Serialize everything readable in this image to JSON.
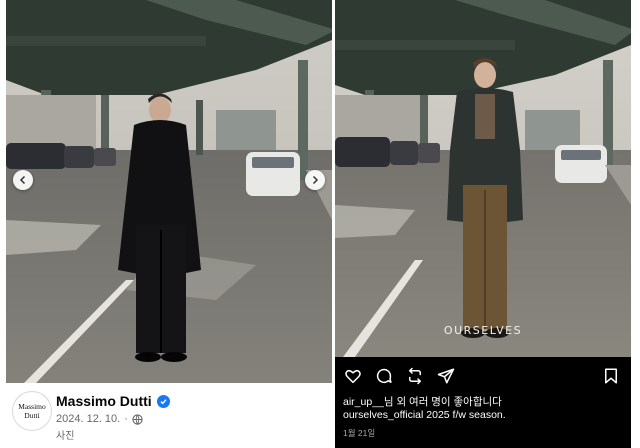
{
  "left_post": {
    "page_name": "Massimo Dutti",
    "avatar_logo_text": "Massimo Dutti",
    "date": "2024. 12. 10.",
    "separator": "·",
    "post_type": "사진",
    "brand_color": "#1877f2",
    "icons": [
      "chevron-left-icon",
      "chevron-right-icon",
      "verified-badge-icon",
      "globe-icon"
    ]
  },
  "right_post": {
    "brand_overlay": "OURSELVES",
    "liker": "air_up__",
    "likes_suffix": "님 외 여러 명이 좋아합니다",
    "caption_user": "ourselves_official",
    "caption_text": " 2025 f/w season.",
    "timestamp": "1월 21일",
    "icons": [
      "heart-icon",
      "comment-icon",
      "repost-icon",
      "share-icon",
      "bookmark-icon"
    ]
  }
}
